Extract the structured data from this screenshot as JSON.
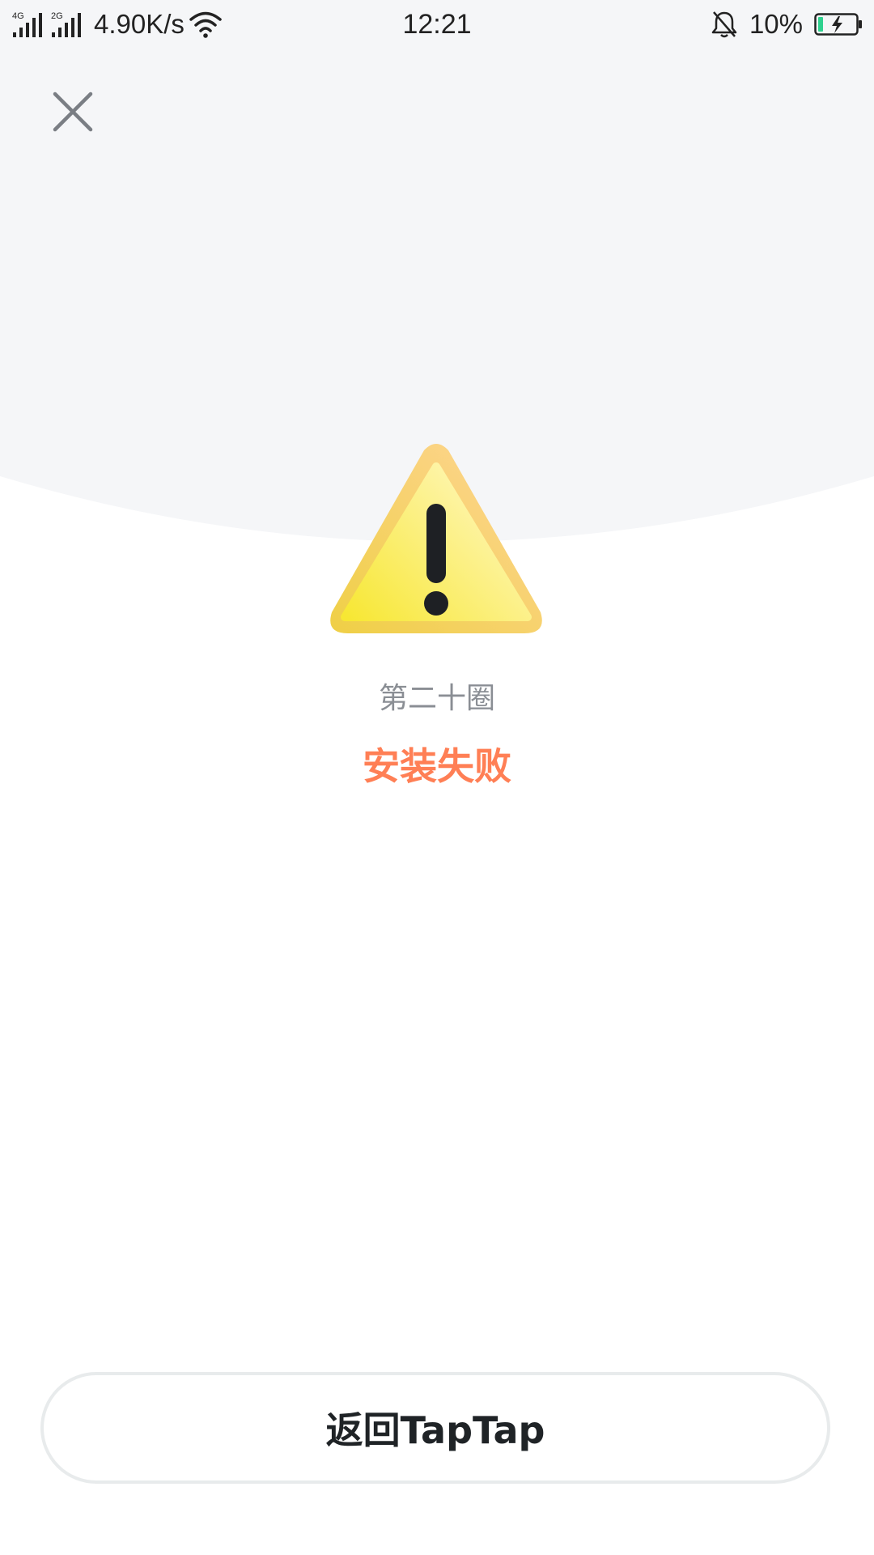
{
  "status_bar": {
    "signal_1": "4G",
    "signal_2": "2G",
    "net_speed": "4.90K/s",
    "time": "12:21",
    "battery_percent": "10%",
    "icons": [
      "signal-icon",
      "wifi-icon",
      "bell-off-icon",
      "battery-charging-icon"
    ]
  },
  "close": {
    "icon": "close-icon"
  },
  "result": {
    "icon": "warning-icon",
    "app_name": "第二十圈",
    "status": "安装失败"
  },
  "footer": {
    "return_label": "返回TapTap"
  },
  "colors": {
    "background_top": "#f5f6f8",
    "status_text": "#ff7f55",
    "app_name_text": "#8a8e94",
    "button_border": "#e8ebec",
    "battery_green": "#2fd18f"
  }
}
